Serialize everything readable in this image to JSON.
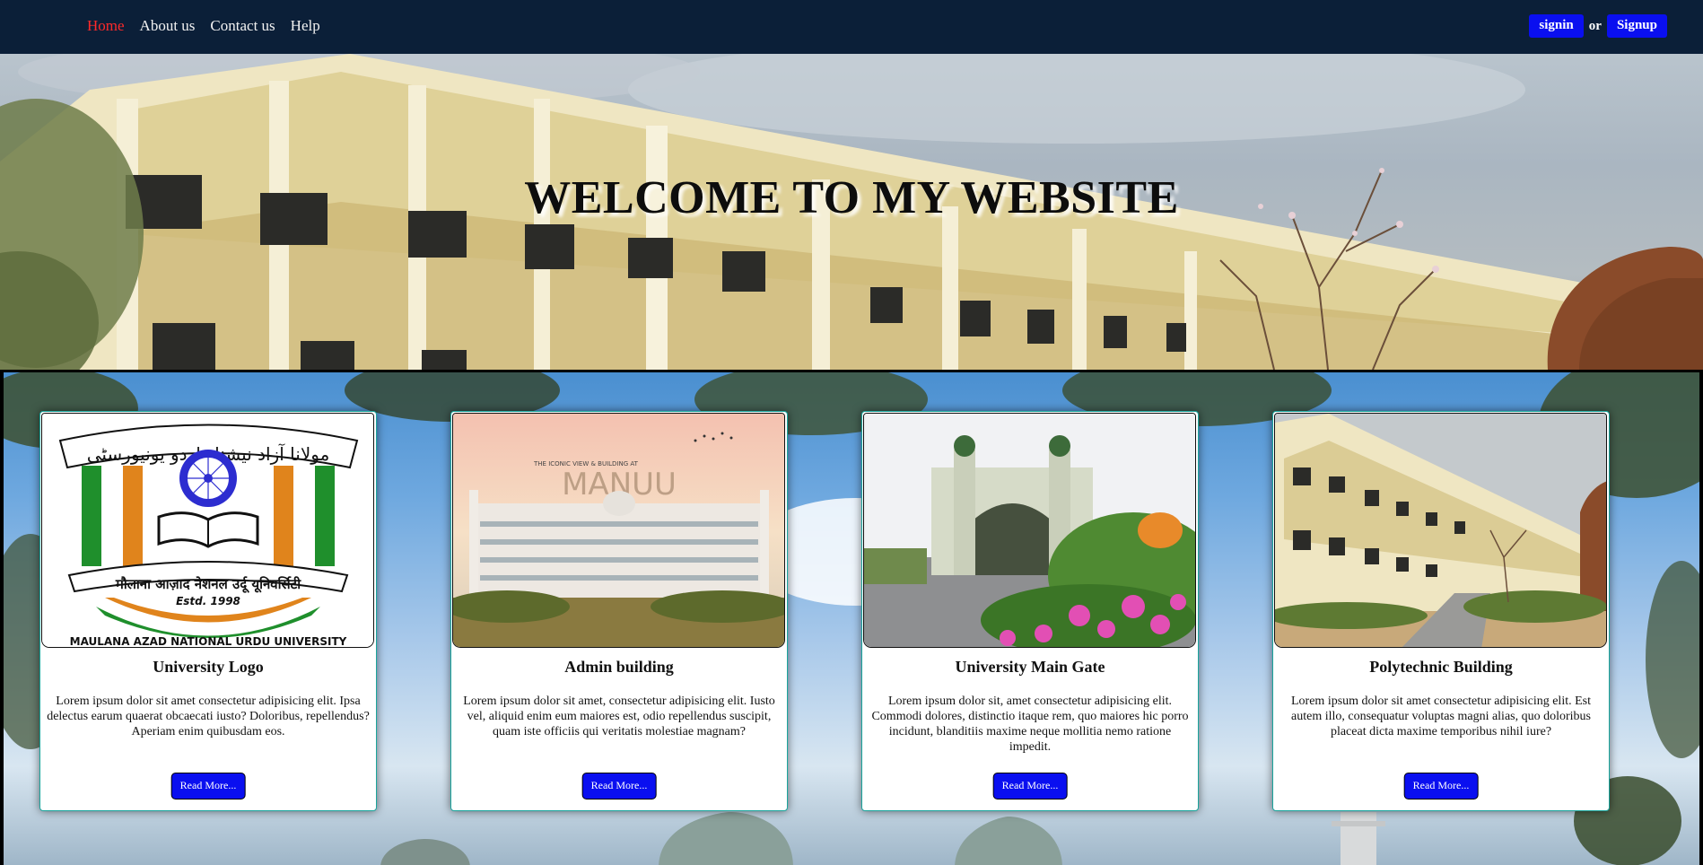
{
  "nav": {
    "links": [
      "Home",
      "About us",
      "Contact us",
      "Help"
    ],
    "active_color": "#ff2a2a",
    "signin": "signin",
    "or": "or",
    "signup": "Signup"
  },
  "hero": {
    "title": "WELCOME TO MY WEBSITE"
  },
  "cards": [
    {
      "title": "University Logo",
      "text": "Lorem ipsum dolor sit amet consectetur adipisicing elit. Ipsa delectus earum quaerat obcaecati iusto? Doloribus, repellendus? Aperiam enim quibusdam eos.",
      "button": "Read More...",
      "image": {
        "top_text": "مولانا آزاد نیشنل اردو یونیورسٹی",
        "hindi_text": "मौलाना आज़ाद नेशनल उर्दू यूनिवर्सिटी",
        "estd": "Estd. 1998",
        "bottom_text": "MAULANA AZAD NATIONAL URDU UNIVERSITY"
      }
    },
    {
      "title": "Admin building",
      "text": "Lorem ipsum dolor sit amet, consectetur adipisicing elit. Iusto vel, aliquid enim eum maiores est, odio repellendus suscipit, quam iste officiis qui veritatis molestiae magnam?",
      "button": "Read More...",
      "image": {
        "caption_small": "THE ICONIC VIEW & BUILDING AT",
        "caption_big": "MANUU"
      }
    },
    {
      "title": "University Main Gate",
      "text": "Lorem ipsum dolor sit, amet consectetur adipisicing elit. Commodi dolores, distinctio itaque rem, quo maiores hic porro incidunt, blanditiis maxime neque mollitia nemo ratione impedit.",
      "button": "Read More..."
    },
    {
      "title": "Polytechnic Building",
      "text": "Lorem ipsum dolor sit amet consectetur adipisicing elit. Est autem illo, consequatur voluptas magni alias, quo doloribus placeat dicta maxime temporibus nihil iure?",
      "button": "Read More..."
    }
  ],
  "colors": {
    "navbar": "#0b1f38",
    "button": "#0a0ff0",
    "card_border": "#1aa59c"
  }
}
